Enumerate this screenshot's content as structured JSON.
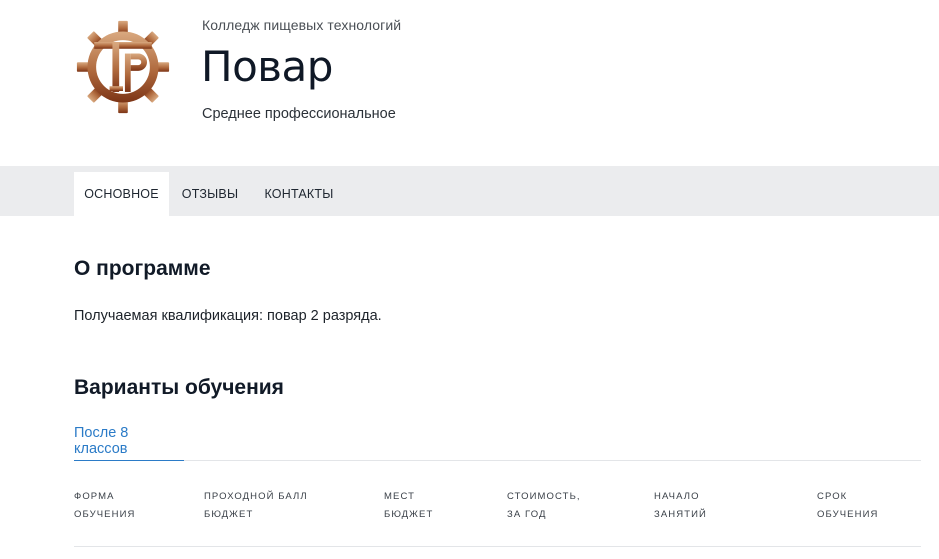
{
  "header": {
    "college_name": "Колледж пищевых технологий",
    "program_title": "Повар",
    "education_level": "Среднее профессиональное",
    "logo_icon": "gear-logo-icon",
    "logo_colors": [
      "#8a3f1c",
      "#d7a47c"
    ]
  },
  "tabs": [
    {
      "label": "ОСНОВНОЕ",
      "active": true
    },
    {
      "label": "ОТЗЫВЫ",
      "active": false
    },
    {
      "label": "КОНТАКТЫ",
      "active": false
    }
  ],
  "about": {
    "heading": "О программе",
    "qualification": "Получаемая квалификация: повар 2 разряда."
  },
  "variants": {
    "heading": "Варианты обучения",
    "subtabs": [
      {
        "label": "После 8 классов",
        "active": true
      }
    ],
    "columns": [
      {
        "line1": "ФОРМА",
        "line2": "ОБУЧЕНИЯ"
      },
      {
        "line1": "ПРОХОДНОЙ БАЛЛ",
        "line2": "БЮДЖЕТ"
      },
      {
        "line1": "МЕСТ",
        "line2": "БЮДЖЕТ"
      },
      {
        "line1": "СТОИМОСТЬ,",
        "line2": "ЗА ГОД"
      },
      {
        "line1": "НАЧАЛО",
        "line2": "ЗАНЯТИЙ"
      },
      {
        "line1": "СРОК",
        "line2": "ОБУЧЕНИЯ"
      }
    ]
  },
  "colors": {
    "accent": "#2b7bc7",
    "tab_bar": "#ebecee",
    "heading": "#111a27"
  }
}
